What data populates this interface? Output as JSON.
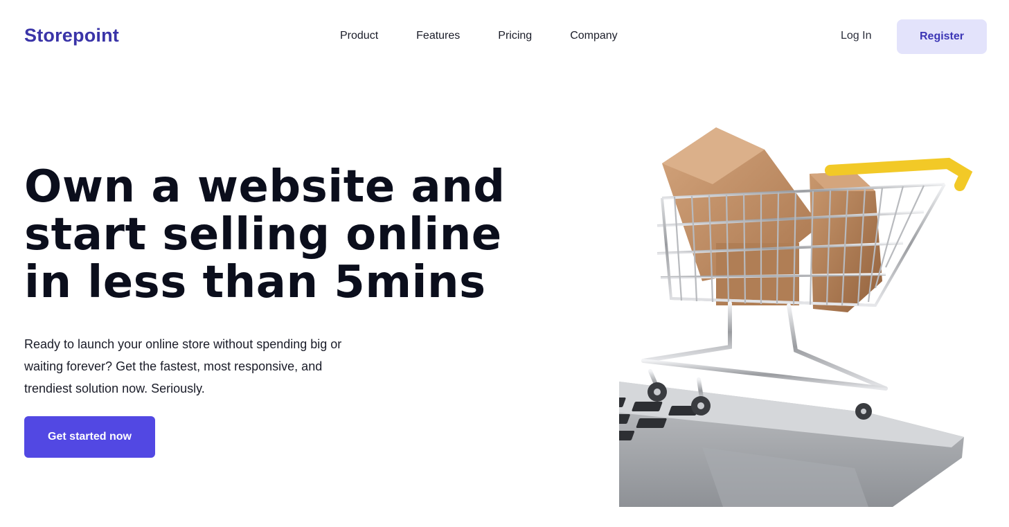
{
  "nav": {
    "logo": "Storepoint",
    "links": [
      "Product",
      "Features",
      "Pricing",
      "Company"
    ],
    "login": "Log In",
    "register": "Register"
  },
  "hero": {
    "headline_lines": [
      "Own a website and",
      "start selling online",
      "in less than 5mins"
    ],
    "subtext": "Ready to launch your online store without spending big or waiting forever? Get the fastest, most responsive, and trendiest solution now. Seriously.",
    "cta": "Get started now",
    "image": "shopping-cart-on-laptop"
  },
  "colors": {
    "brand": "#3a34a8",
    "cta_bg": "#5248e3",
    "register_bg": "#e3e3fb",
    "register_text": "#3b35b5",
    "heading": "#0b0e1c"
  }
}
